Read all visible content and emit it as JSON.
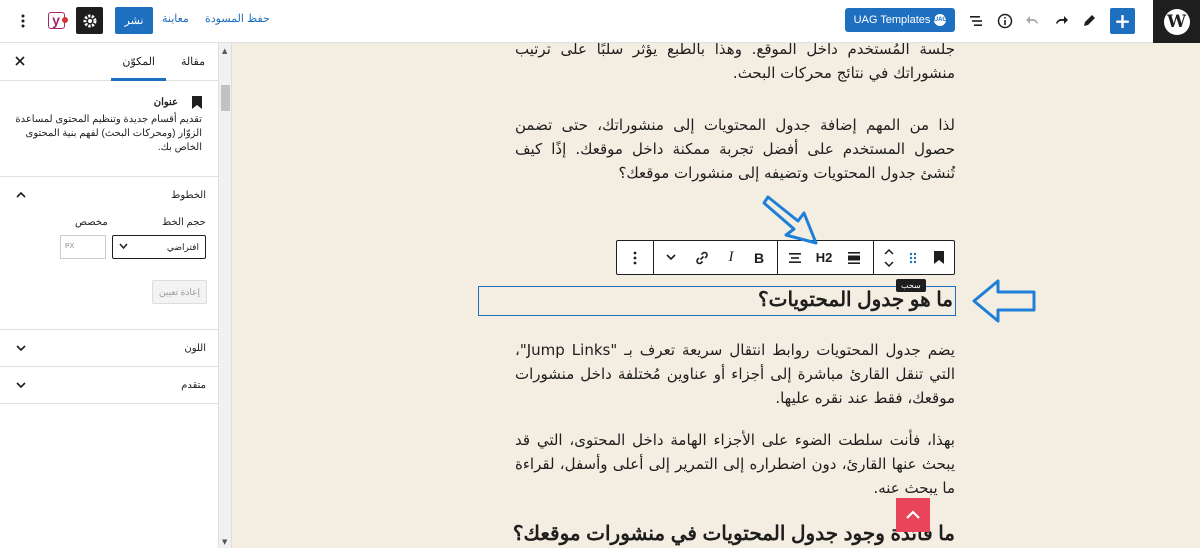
{
  "topbar": {
    "save_draft": "حفظ المسودة",
    "preview": "معاينة",
    "publish": "نشر",
    "uag_templates": "UAG Templates",
    "uag_badge": "UAG",
    "yoast_letter": "y"
  },
  "sidebar": {
    "tab_post": "مقالة",
    "tab_block": "المكوّن",
    "block_title": "عنوان",
    "block_description": "تقديم أقسام جديدة وتنظيم المحتوى لمساعدة الزوّار (ومحركات البحث) لفهم بنية المحتوى الخاص بك.",
    "typography_title": "الخطوط",
    "font_size_label": "حجم الخط",
    "custom_label": "مخصص",
    "font_size_value": "افتراضي",
    "custom_placeholder": "PX",
    "reset_button": "إعادة تعيين",
    "color_title": "اللون",
    "advanced_title": "متقدم"
  },
  "content": {
    "para0": "جلسة المُستخدم داخل الموقع. وهذا بالطبع يؤثر سلبًا على ترتيب منشوراتك في نتائج محركات البحث.",
    "para1": "لذا من المهم إضافة جدول المحتويات إلى منشوراتك، حتى تضمن حصول المستخدم على أفضل تجربة ممكنة داخل موقعك. إذًا كيف تُنشئ جدول المحتويات وتضيفه إلى منشورات موقعك؟",
    "heading_selected": "ما هو جدول المحتويات؟",
    "para2": "يضم جدول المحتويات روابط انتقال سريعة تعرف بـ \"Jump Links\"، التي تنقل القارئ مباشرة إلى أجزاء أو عناوين مُختلفة داخل منشورات موقعك، فقط عند نقره عليها.",
    "para3": "بهذا، فأنت سلطت الضوء على الأجزاء الهامة داخل المحتوى، التي قد يبحث عنها القارئ، دون اضطراره إلى التمرير إلى أعلى وأسفل، لقراءة ما يبحث عنه.",
    "heading2": "ما فائدة وجود جدول المحتويات في منشورات موقعك؟"
  },
  "block_toolbar": {
    "heading_level": "H2",
    "bold": "B",
    "italic": "I",
    "drag_tooltip": "سحب"
  },
  "colors": {
    "accent": "#1e6fbf",
    "canvas_bg": "#f4ede1",
    "annotation_arrow": "#1e7fd8",
    "scroll_top_bg": "#e8445a"
  }
}
